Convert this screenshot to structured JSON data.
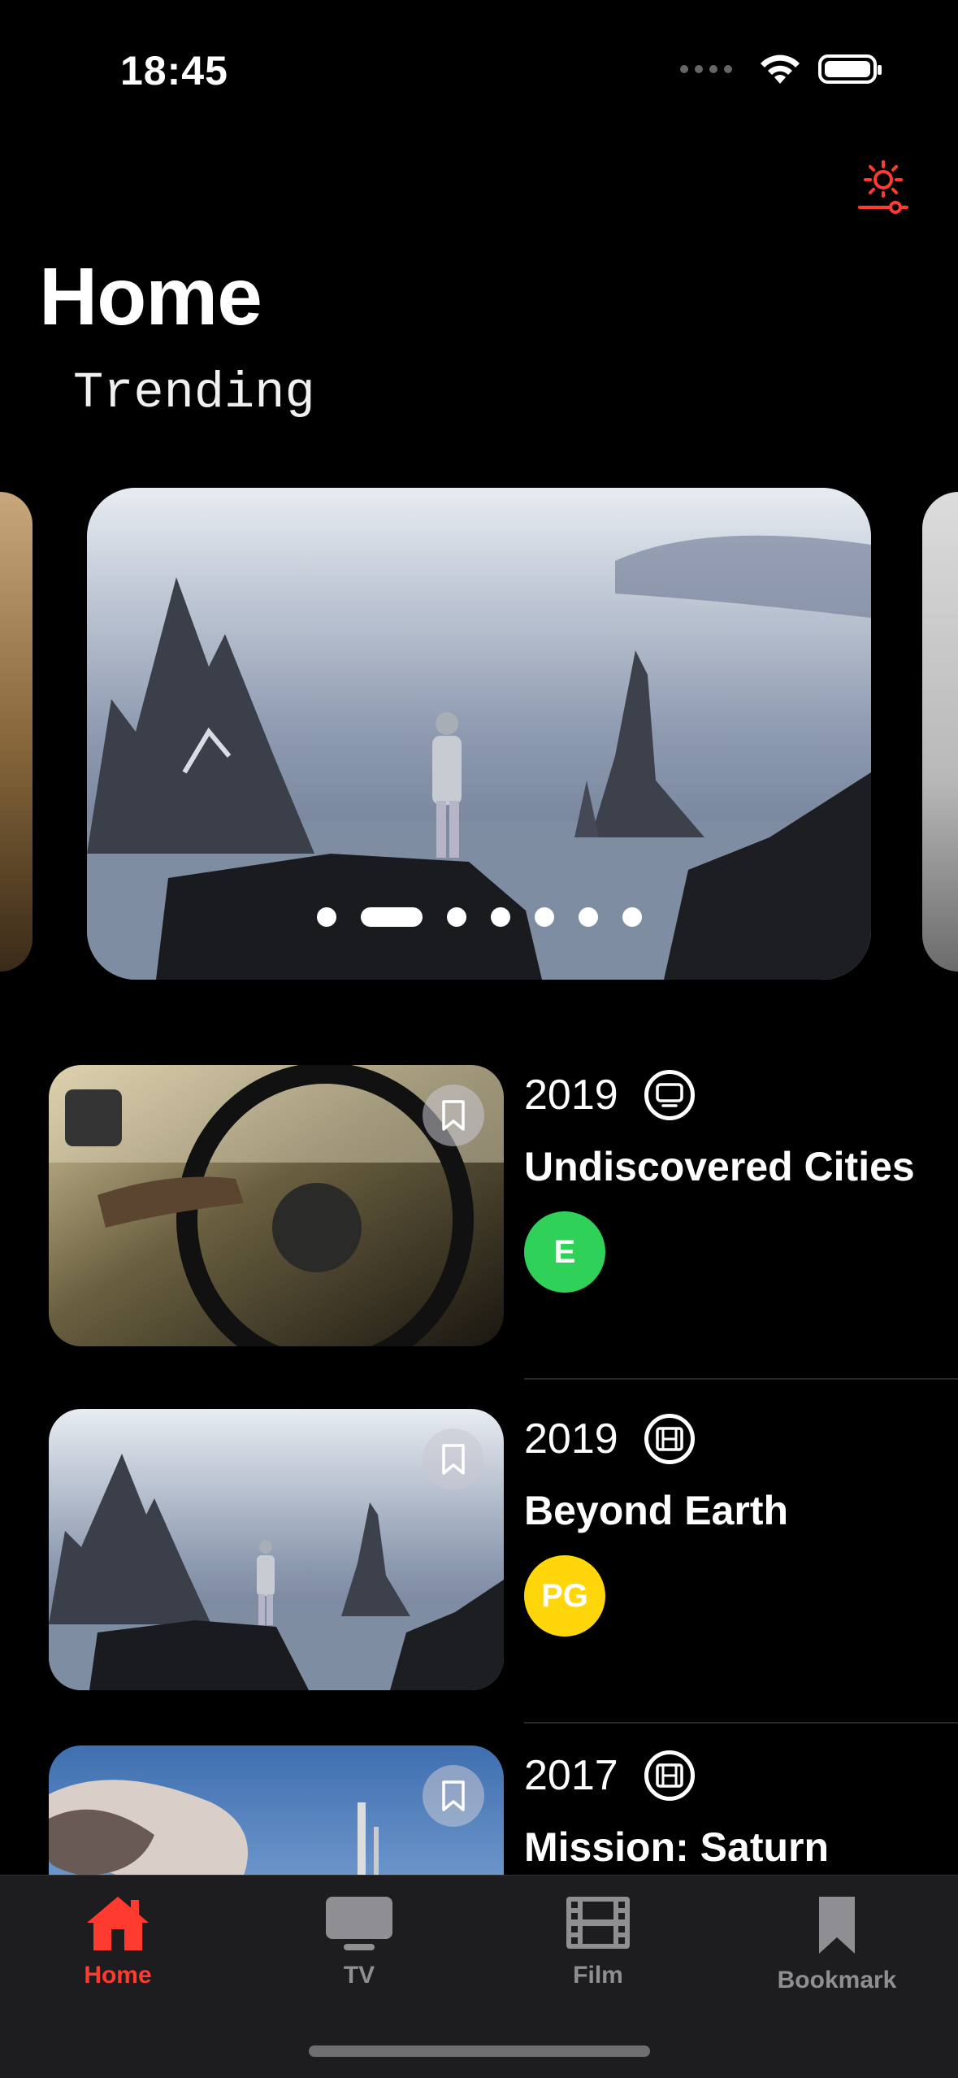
{
  "status_bar": {
    "time": "18:45"
  },
  "header": {
    "title": "Home",
    "section": "Trending"
  },
  "carousel": {
    "page_count": 7,
    "active_index": 1
  },
  "items": [
    {
      "year": "2019",
      "type": "tv",
      "title": "Undiscovered Cities",
      "rating": "E",
      "rating_color": "#30d158"
    },
    {
      "year": "2019",
      "type": "film",
      "title": "Beyond Earth",
      "rating": "PG",
      "rating_color": "#ffd60a"
    },
    {
      "year": "2017",
      "type": "film",
      "title": "Mission: Saturn",
      "rating": "",
      "rating_color": ""
    }
  ],
  "tabs": [
    {
      "label": "Home",
      "icon": "house-icon",
      "active": true
    },
    {
      "label": "TV",
      "icon": "tv-icon",
      "active": false
    },
    {
      "label": "Film",
      "icon": "film-icon",
      "active": false
    },
    {
      "label": "Bookmark",
      "icon": "bookmark-icon",
      "active": false
    }
  ],
  "colors": {
    "accent": "#ff3b30",
    "tab_inactive": "#8e8e93"
  }
}
